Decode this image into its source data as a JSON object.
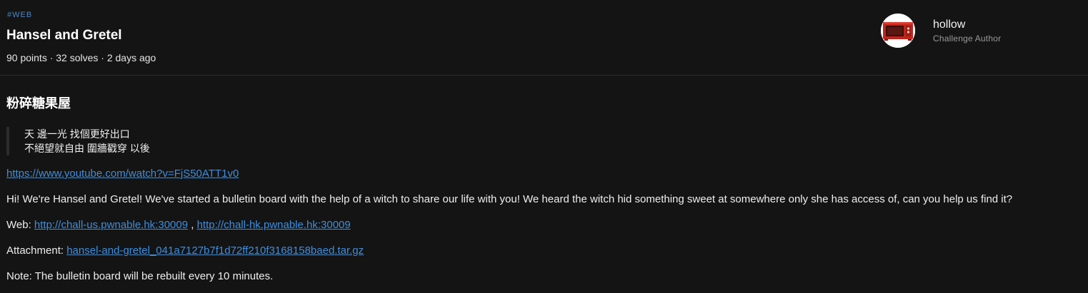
{
  "challenge": {
    "tag": "#WEB",
    "title": "Hansel and Gretel",
    "meta": "90 points · 32 solves · 2 days ago"
  },
  "author": {
    "name": "hollow",
    "role": "Challenge Author",
    "avatar_icon": "microwave-icon"
  },
  "description": {
    "heading": "粉碎糖果屋",
    "quote_line1": "天 邊一光 找個更好出口",
    "quote_line2": "不絕望就自由 圍牆戳穿 以後",
    "youtube_link": "https://www.youtube.com/watch?v=FjS50ATT1v0",
    "body": "Hi! We're Hansel and Gretel! We've started a bulletin board with the help of a witch to share our life with you! We heard the witch hid something sweet at somewhere only she has access of, can you help us find it?",
    "web_label": "Web:",
    "web_link_us": "http://chall-us.pwnable.hk:30009",
    "web_separator": ",",
    "web_link_hk": "http://chall-hk.pwnable.hk:30009",
    "attachment_label": "Attachment:",
    "attachment_link": "hansel-and-gretel_041a7127b7f1d72ff210f3168158baed.tar.gz",
    "note": "Note: The bulletin board will be rebuilt every 10 minutes."
  },
  "colors": {
    "background": "#141414",
    "tag": "#4a86c8",
    "link": "#3d8fe0",
    "divider": "#2e2e2e"
  }
}
